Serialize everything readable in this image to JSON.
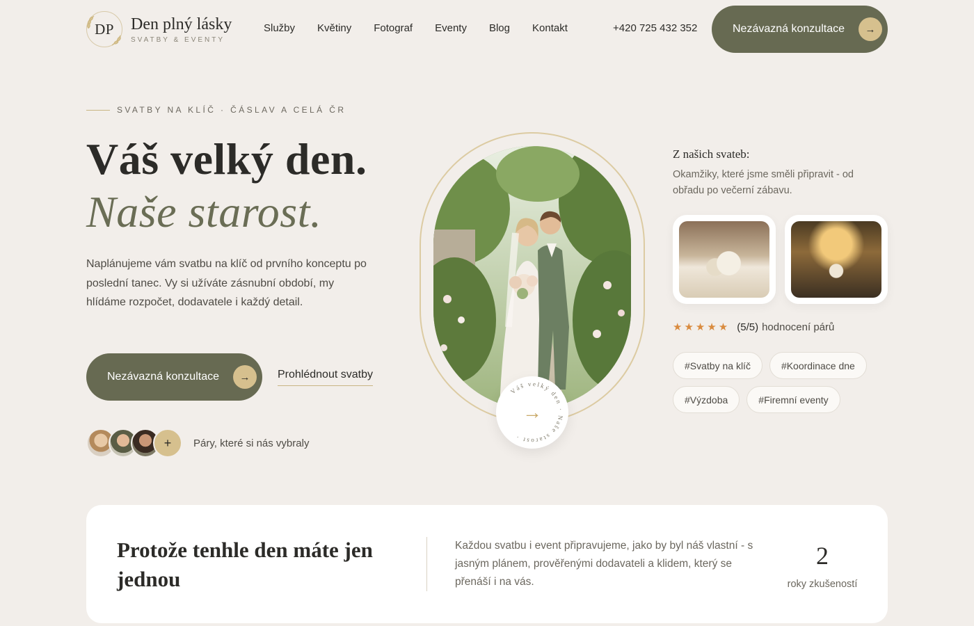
{
  "brand": {
    "monogram": "DP",
    "name": "Den plný lásky",
    "tagline": "SVATBY & EVENTY"
  },
  "nav": {
    "items": [
      {
        "label": "Služby"
      },
      {
        "label": "Květiny"
      },
      {
        "label": "Fotograf"
      },
      {
        "label": "Eventy"
      },
      {
        "label": "Blog"
      },
      {
        "label": "Kontakt"
      }
    ],
    "phone": "+420 725 432 352",
    "cta_label": "Nezávazná konzultace"
  },
  "hero": {
    "eyebrow": "SVATBY NA KLÍČ · ČÁSLAV A CELÁ ČR",
    "title_line1": "Váš velký den.",
    "title_line2": "Naše starost.",
    "lead": "Naplánujeme vám svatbu na klíč od prvního konceptu po poslední tanec. Vy si užíváte zásnubní období, my hlídáme rozpočet, dodavatele i každý detail.",
    "primary_cta": "Nezávazná konzultace",
    "secondary_cta": "Prohlédnout svatby",
    "avatars_more": "+",
    "avatars_label": "Páry, které si nás vybraly",
    "badge_text": "Váš velký den · Naše starost ·"
  },
  "gallery": {
    "title": "Z našich svateb:",
    "description": "Okamžiky, které jsme směli připravit - od obřadu po večerní zábavu.",
    "stars": "★★★★★",
    "rating_value": "(5/5)",
    "rating_label": "hodnocení párů",
    "tags": [
      {
        "label": "#Svatby na klíč"
      },
      {
        "label": "#Koordinace dne"
      },
      {
        "label": "#Výzdoba"
      },
      {
        "label": "#Firemní eventy"
      }
    ]
  },
  "intro_card": {
    "title": "Protože tenhle den máte jen jednou",
    "text": "Každou svatbu i event připravujeme, jako by byl náš vlastní - s jasným plánem, prověřenými dodavateli a klidem, který se přenáší i na vás.",
    "stat_value": "2",
    "stat_label": "roky zkušeností"
  },
  "colors": {
    "background": "#f2eeea",
    "olive": "#676a52",
    "gold": "#d6c08e",
    "star": "#d98b3f"
  },
  "icons": {
    "arrow": "arrow-right-icon",
    "plus": "plus-icon",
    "star": "star-icon",
    "laurel": "laurel-icon"
  }
}
